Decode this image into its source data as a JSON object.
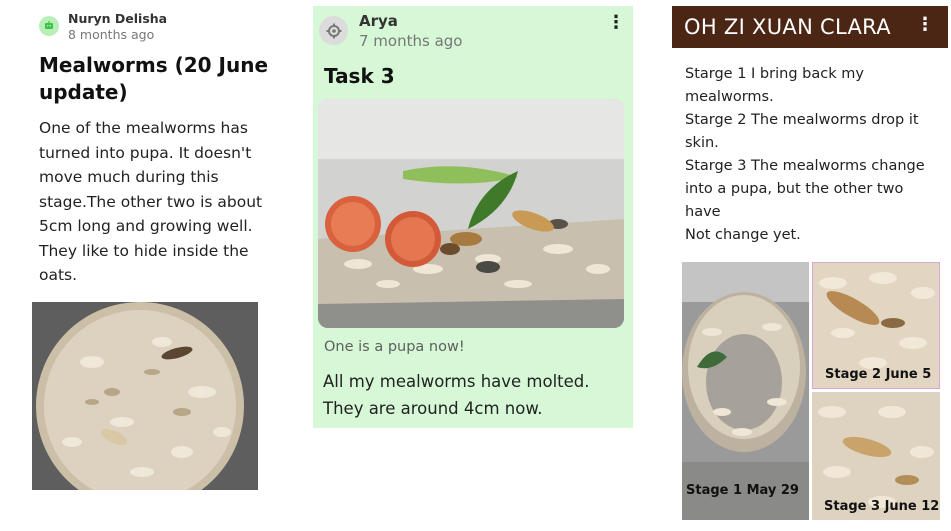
{
  "post1": {
    "author": "Nuryn Delisha",
    "time": "8 months ago",
    "title": "Mealworms (20 June update)",
    "body": "One of the mealworms has turned into pupa. It doesn't move much during this stage.The other two is about 5cm long and growing well. They like to hide inside the oats.",
    "avatar_icon": "robot-avatar-icon"
  },
  "post2": {
    "author": "Arya",
    "time": "7 months ago",
    "title": "Task 3",
    "caption": "One is a pupa now!",
    "body": "All my mealworms have molted. They are around 4cm now.",
    "menu_icon": "more-vertical-icon",
    "avatar_icon": "gear-avatar-icon"
  },
  "post3": {
    "title": "OH ZI XUAN CLARA",
    "lines": [
      "Starge 1  I  bring  back my",
      "mealworms.",
      "Starge 2  The mealworms drop it",
      "skin.",
      "Starge 3 The mealworms change",
      "into a  pupa, but the other  two",
      "have",
      "Not  change  yet."
    ],
    "labels": {
      "stage1": "Stage 1  May 29",
      "stage2": "Stage 2 June 5",
      "stage3": "Stage 3 June 12"
    },
    "menu_icon": "more-vertical-icon"
  },
  "colors": {
    "post2_bg": "#d6f8d6",
    "post3_header": "#4c2615",
    "avatar1_bg": "#b9efb7"
  }
}
